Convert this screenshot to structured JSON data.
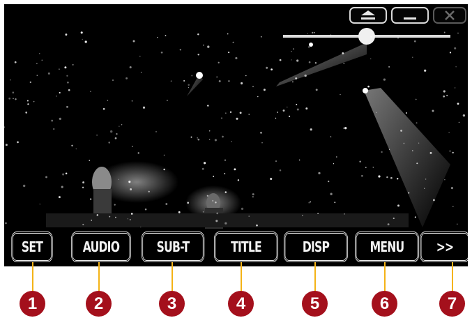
{
  "window_controls": [
    {
      "name": "eject-icon"
    },
    {
      "name": "minimize-icon"
    },
    {
      "name": "close-icon"
    }
  ],
  "control_bar": {
    "buttons": [
      {
        "label": "SET"
      },
      {
        "label": "AUDIO"
      },
      {
        "label": "SUB-T"
      },
      {
        "label": "TITLE"
      },
      {
        "label": "DISP"
      },
      {
        "label": "MENU"
      },
      {
        "label": ">>"
      }
    ]
  },
  "callouts": [
    "1",
    "2",
    "3",
    "4",
    "5",
    "6",
    "7"
  ],
  "colors": {
    "screen_background": "#000000",
    "button_border": "#ececec",
    "callout_circle": "#a4101c",
    "callout_line": "#f4b316"
  }
}
